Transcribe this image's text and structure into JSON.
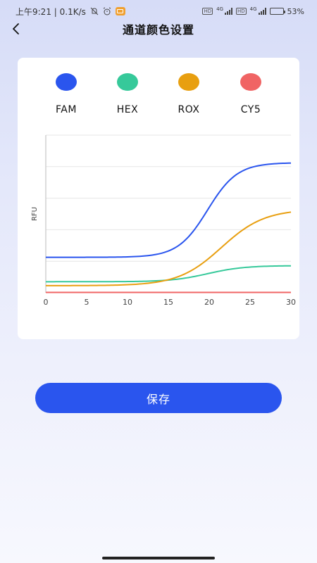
{
  "status_bar": {
    "time_speed": "上午9:21 | 0.1K/s",
    "network_1": "4G",
    "network_2": "4G",
    "battery": "53%",
    "battery_level": 0.53
  },
  "header": {
    "title": "通道颜色设置"
  },
  "channels": [
    {
      "name": "FAM",
      "color": "#2a55ee"
    },
    {
      "name": "HEX",
      "color": "#36c99a"
    },
    {
      "name": "ROX",
      "color": "#e89f10"
    },
    {
      "name": "CY5",
      "color": "#f06464"
    }
  ],
  "chart_data": {
    "type": "line",
    "ylabel": "RFU",
    "xlabel": "",
    "xlim": [
      0,
      30
    ],
    "ylim": [
      0,
      10
    ],
    "x_ticks": [
      "0",
      "5",
      "10",
      "15",
      "20",
      "25",
      "30"
    ],
    "grid": true,
    "series": [
      {
        "name": "FAM",
        "color": "#2a55ee",
        "baseline": 2.25,
        "plateau": 8.25,
        "midpoint": 19.8,
        "steepness": 0.55
      },
      {
        "name": "HEX",
        "color": "#36c99a",
        "baseline": 0.7,
        "plateau": 1.72,
        "midpoint": 19.8,
        "steepness": 0.45
      },
      {
        "name": "ROX",
        "color": "#e89f10",
        "baseline": 0.45,
        "plateau": 5.3,
        "midpoint": 21.5,
        "steepness": 0.38
      },
      {
        "name": "CY5",
        "color": "#f06464",
        "baseline": 0.02,
        "plateau": 0.02,
        "midpoint": 20,
        "steepness": 0.5
      }
    ]
  },
  "actions": {
    "save_label": "保存"
  }
}
